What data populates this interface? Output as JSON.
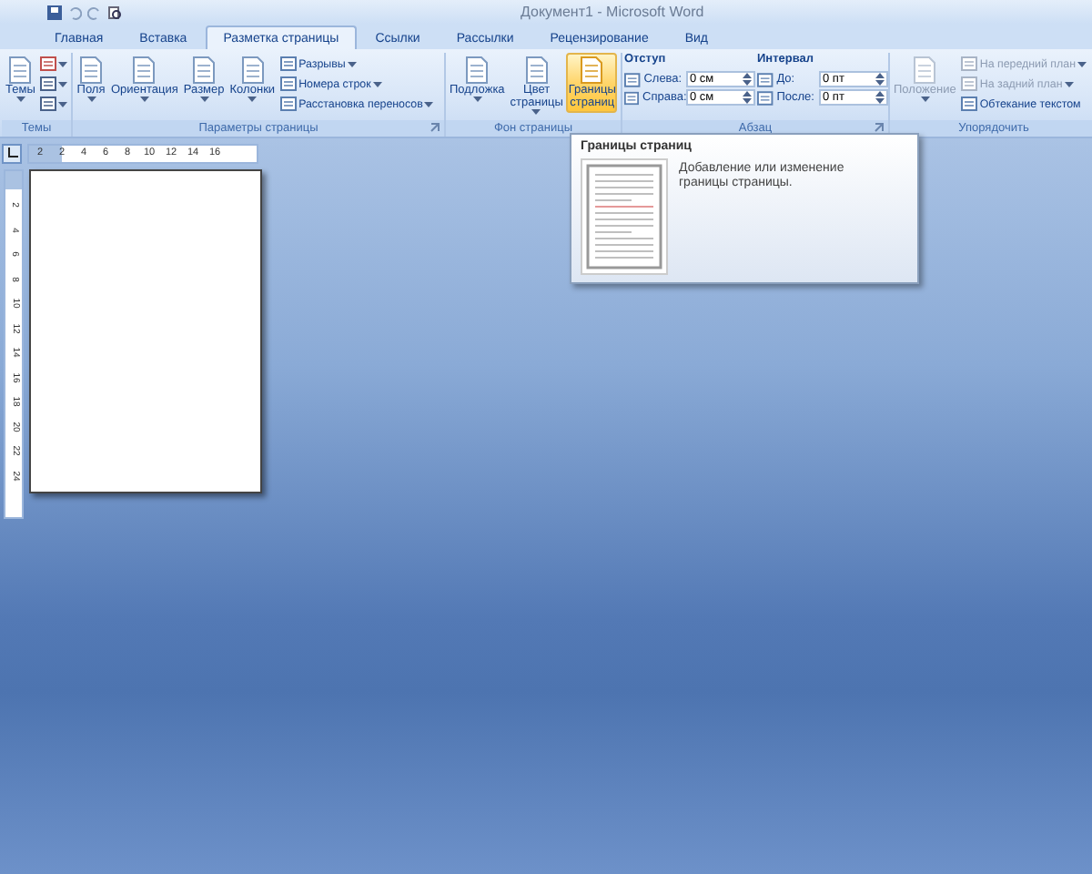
{
  "window": {
    "title": "Документ1 - Microsoft Word"
  },
  "tabs": [
    {
      "label": "Главная",
      "selected": false
    },
    {
      "label": "Вставка",
      "selected": false
    },
    {
      "label": "Разметка страницы",
      "selected": true
    },
    {
      "label": "Ссылки",
      "selected": false
    },
    {
      "label": "Рассылки",
      "selected": false
    },
    {
      "label": "Рецензирование",
      "selected": false
    },
    {
      "label": "Вид",
      "selected": false
    }
  ],
  "ribbon": {
    "groups": [
      {
        "label": "Темы",
        "launcher": false,
        "controls": [
          {
            "kind": "large",
            "label": "Темы",
            "dropdown": true,
            "highlighted": false,
            "disabled": false
          },
          {
            "kind": "themeoptions"
          }
        ]
      },
      {
        "label": "Параметры страницы",
        "launcher": true,
        "controls": [
          {
            "kind": "large",
            "label": "Поля",
            "dropdown": true,
            "highlighted": false,
            "disabled": false
          },
          {
            "kind": "large",
            "label": "Ориентация",
            "dropdown": true,
            "highlighted": false,
            "disabled": false
          },
          {
            "kind": "large",
            "label": "Размер",
            "dropdown": true,
            "highlighted": false,
            "disabled": false
          },
          {
            "kind": "large",
            "label": "Колонки",
            "dropdown": true,
            "highlighted": false,
            "disabled": false
          },
          {
            "kind": "smalllist",
            "items": [
              {
                "label": "Разрывы",
                "dropdown": true,
                "disabled": false
              },
              {
                "label": "Номера строк",
                "dropdown": true,
                "disabled": false
              },
              {
                "label": "Расстановка переносов",
                "dropdown": true,
                "disabled": false
              }
            ]
          }
        ]
      },
      {
        "label": "Фон страницы",
        "launcher": false,
        "controls": [
          {
            "kind": "large",
            "label": "Подложка",
            "dropdown": true,
            "highlighted": false,
            "disabled": false
          },
          {
            "kind": "large",
            "label": "Цвет страницы",
            "dropdown": true,
            "highlighted": false,
            "disabled": false
          },
          {
            "kind": "large",
            "label": "Границы страниц",
            "dropdown": false,
            "highlighted": true,
            "disabled": false
          }
        ]
      },
      {
        "label": "Абзац",
        "launcher": true,
        "controls": [
          {
            "kind": "spinners",
            "heading": "Отступ",
            "rows": [
              {
                "label": "Слева:",
                "value": "0 см"
              },
              {
                "label": "Справа:",
                "value": "0 см"
              }
            ]
          },
          {
            "kind": "spinners",
            "heading": "Интервал",
            "rows": [
              {
                "label": "До:",
                "value": "0 пт"
              },
              {
                "label": "После:",
                "value": "0 пт"
              }
            ]
          }
        ]
      },
      {
        "label": "Упорядочить",
        "launcher": false,
        "controls": [
          {
            "kind": "large",
            "label": "Положение",
            "dropdown": true,
            "highlighted": false,
            "disabled": true
          },
          {
            "kind": "smalllist",
            "items": [
              {
                "label": "На передний план",
                "dropdown": true,
                "disabled": true
              },
              {
                "label": "На задний план",
                "dropdown": true,
                "disabled": true
              },
              {
                "label": "Обтекание текстом",
                "dropdown": false,
                "disabled": false
              }
            ]
          }
        ]
      }
    ]
  },
  "ruler": {
    "horizontal": [
      "2",
      "2",
      "4",
      "6",
      "8",
      "10",
      "12",
      "14",
      "16"
    ],
    "vertical": [
      "2",
      "4",
      "6",
      "8",
      "10",
      "12",
      "14",
      "16",
      "18",
      "20",
      "22",
      "24"
    ]
  },
  "tooltip": {
    "title": "Границы страниц",
    "description": "Добавление или изменение границы страницы."
  }
}
